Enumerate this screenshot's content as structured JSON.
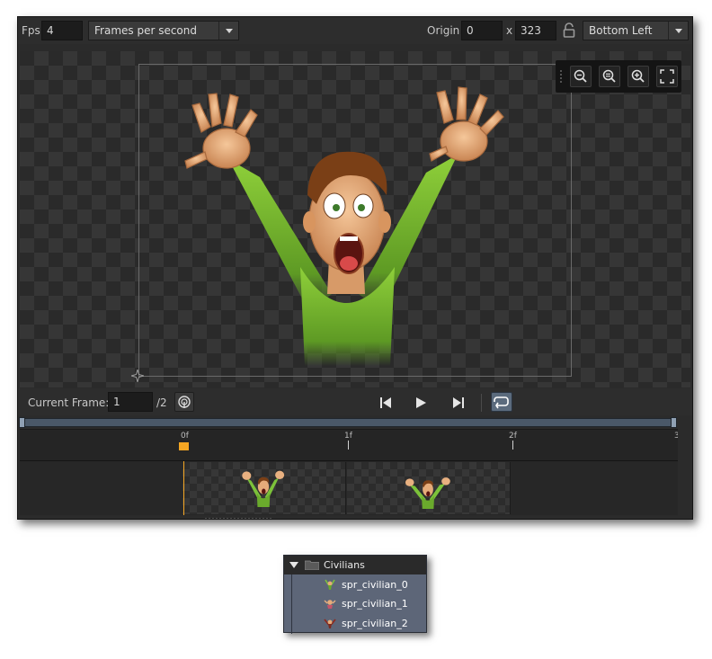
{
  "topbar": {
    "fps_label": "Fps",
    "fps_value": "4",
    "fps_mode": "Frames per second",
    "origin_label": "Origin",
    "origin_x": "0",
    "origin_sep": "x",
    "origin_y": "323",
    "origin_preset": "Bottom Left"
  },
  "controls": {
    "current_frame_label": "Current Frame:",
    "current_frame_value": "1",
    "frame_total": "/2"
  },
  "timeline": {
    "ticks": [
      "0f",
      "1f",
      "2f",
      "3"
    ]
  },
  "tree": {
    "folder_label": "Civilians",
    "items": [
      "spr_civilian_0",
      "spr_civilian_1",
      "spr_civilian_2"
    ]
  },
  "colors": {
    "accent_playhead": "#f5a623",
    "panel_bg": "#2b2b2b",
    "tree_bg": "#5d6678"
  }
}
